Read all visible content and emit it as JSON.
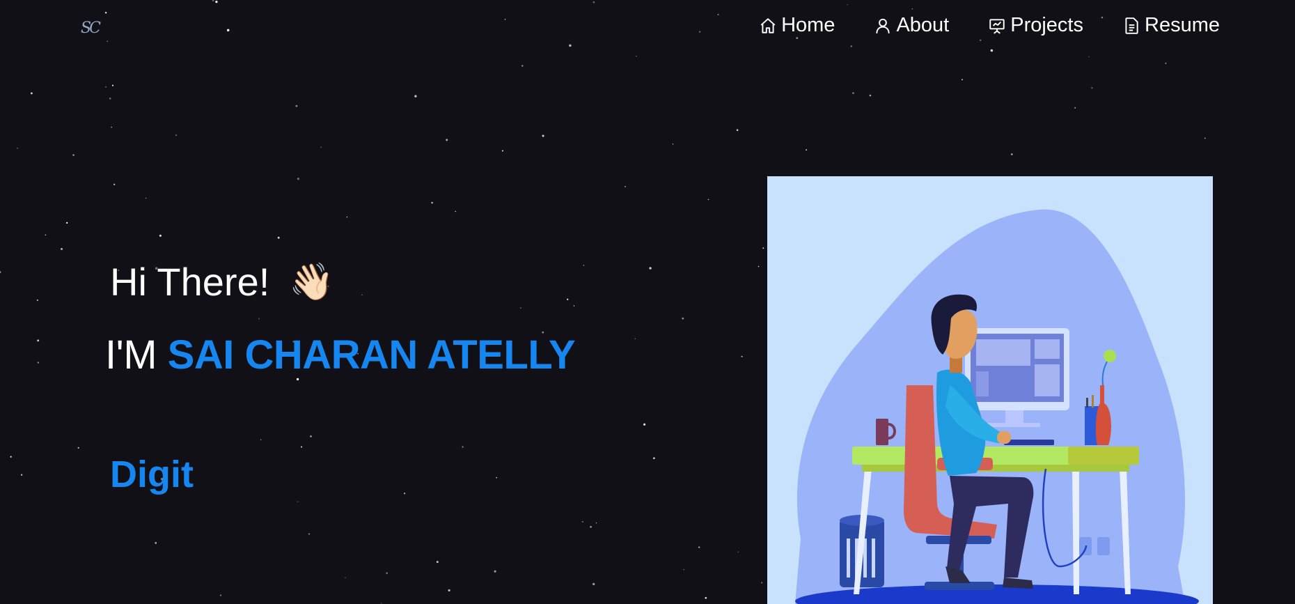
{
  "brand": {
    "logo_text": "SC"
  },
  "nav": {
    "items": [
      {
        "label": "Home",
        "icon": "home-icon"
      },
      {
        "label": "About",
        "icon": "user-icon"
      },
      {
        "label": "Projects",
        "icon": "presentation-icon"
      },
      {
        "label": "Resume",
        "icon": "document-icon"
      }
    ]
  },
  "hero": {
    "greeting": "Hi There!",
    "wave_emoji": "👋🏻",
    "intro_prefix": "I'M",
    "name": "SAI CHARAN ATELLY",
    "typed_text": "Digit",
    "illustration": "developer-at-desk-illustration"
  },
  "colors": {
    "background": "#101016",
    "accent": "#1687f0",
    "illustration_bg": "#c8e1fd",
    "illustration_blob": "#9bb4f9"
  }
}
